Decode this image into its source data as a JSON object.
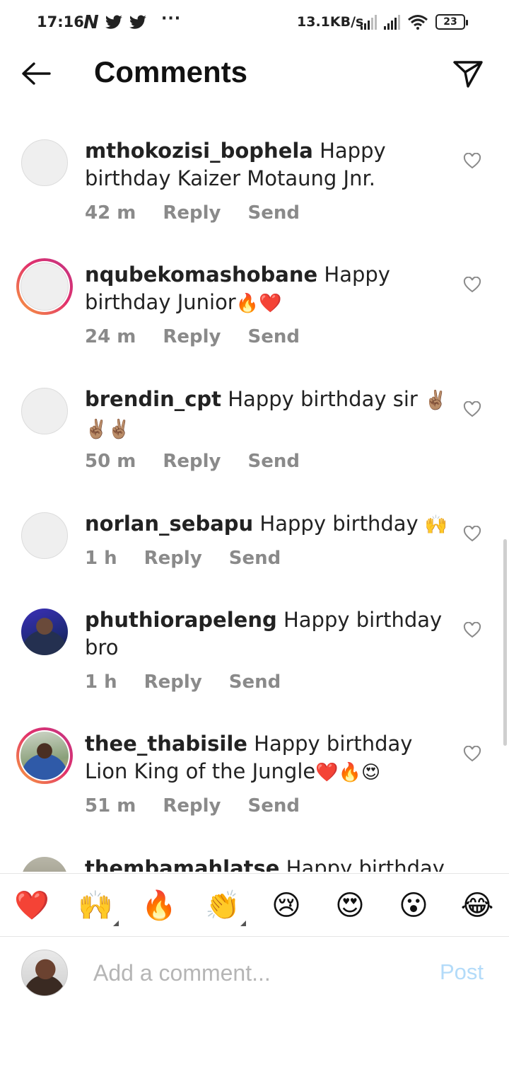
{
  "status_bar": {
    "time": "17:16",
    "app_icons": [
      "N",
      "twitter",
      "twitter"
    ],
    "more": "···",
    "speed": "13.1KB/s",
    "battery": "23"
  },
  "header": {
    "title": "Comments"
  },
  "comments": [
    {
      "user": "mthokozisi_bophela",
      "text": " Happy birthday Kaizer Motaung Jnr.",
      "emojis": "",
      "age": "42 m",
      "reply": "Reply",
      "send": "Send"
    },
    {
      "user": "nqubekomashobane",
      "text": " Happy birthday Junior",
      "emojis": "🔥❤️",
      "age": "24 m",
      "reply": "Reply",
      "send": "Send"
    },
    {
      "user": "brendin_cpt",
      "text": " Happy birthday sir ",
      "emojis": "✌🏽✌🏽✌🏽",
      "age": "50 m",
      "reply": "Reply",
      "send": "Send"
    },
    {
      "user": "norlan_sebapu",
      "text": " Happy birthday ",
      "emojis": "🙌",
      "age": "1 h",
      "reply": "Reply",
      "send": "Send"
    },
    {
      "user": "phuthiorapeleng",
      "text": " Happy birthday bro",
      "emojis": "",
      "age": "1 h",
      "reply": "Reply",
      "send": "Send"
    },
    {
      "user": "thee_thabisile",
      "text": " Happy birthday Lion King of the Jungle",
      "emojis": "❤️🔥😍",
      "age": "51 m",
      "reply": "Reply",
      "send": "Send"
    },
    {
      "user": "thembamahlatse",
      "text": " Happy birthday",
      "emojis": "",
      "age": "",
      "reply": "",
      "send": ""
    }
  ],
  "reactions": [
    "❤️",
    "🙌",
    "🔥",
    "👏",
    "😢",
    "😍",
    "😮",
    "😂"
  ],
  "composer": {
    "placeholder": "Add a comment...",
    "post_label": "Post"
  },
  "colors": {
    "post_disabled": "#b3dbf9",
    "meta_gray": "#8a8a8a"
  }
}
